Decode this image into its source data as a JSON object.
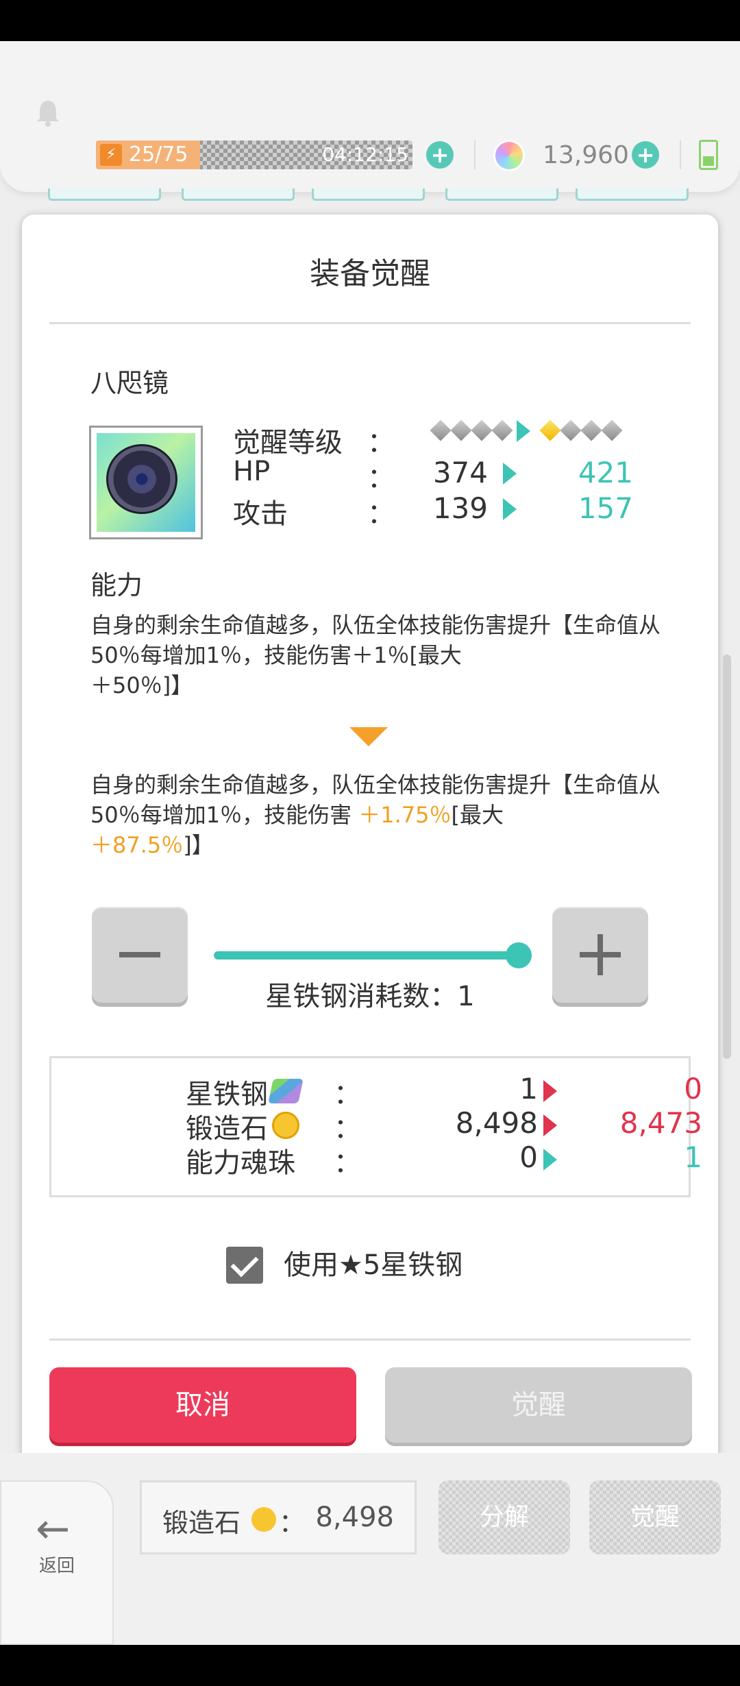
{
  "topbar": {
    "energy": "25/75",
    "energy_fill": 0.33,
    "timer": "04:12:15",
    "gems": "13,960"
  },
  "dialog": {
    "title": "装备觉醒",
    "item_name": "八咫镜",
    "stats": {
      "awaken_level_label": "觉醒等级",
      "awaken_level_old": 0,
      "awaken_level_new": 1,
      "awaken_level_max": 4,
      "hp_label": "HP",
      "hp_old": "374",
      "hp_new": "421",
      "atk_label": "攻击",
      "atk_old": "139",
      "atk_new": "157",
      "colon": "："
    },
    "ability_label": "能力",
    "ability_old": {
      "line1": "自身的剩余生命值越多，队伍全体技能伤害提升【生命值从50％每增加1％，技能伤害＋1％[最大",
      "line2": "＋50％]】"
    },
    "ability_new": {
      "part1": "自身的剩余生命值越多，队伍全体技能伤害提升【生命值从50％每增加1％，技能伤害",
      "hl1": "＋1.75％",
      "part2": "[最大",
      "hl2": "＋87.5％",
      "part3": "]】"
    },
    "slider_value": 1,
    "consume_text": "星铁钢消耗数：1",
    "costs": [
      {
        "label": "星铁钢",
        "old": "1",
        "new": "0",
        "color": "#e0334d"
      },
      {
        "label": "锻造石",
        "old": "8,498",
        "new": "8,473",
        "color": "#e0334d"
      },
      {
        "label": "能力魂珠",
        "old": "0",
        "new": "1",
        "color": "#3cc4b4"
      }
    ],
    "checkbox_label": "使用★5星铁钢",
    "checkbox_checked": true,
    "cancel_label": "取消",
    "awaken_label": "觉醒"
  },
  "bottom": {
    "back_label": "返回",
    "forge_label": "锻造石",
    "forge_colon": "：",
    "forge_value": "8,498",
    "decompose_label": "分解",
    "awaken_label": "觉醒"
  },
  "colors": {
    "accent_teal": "#3cc4b4",
    "cancel_red": "#ee3a5a",
    "highlight_orange": "#f0a020",
    "decrease_red": "#e0334d"
  }
}
